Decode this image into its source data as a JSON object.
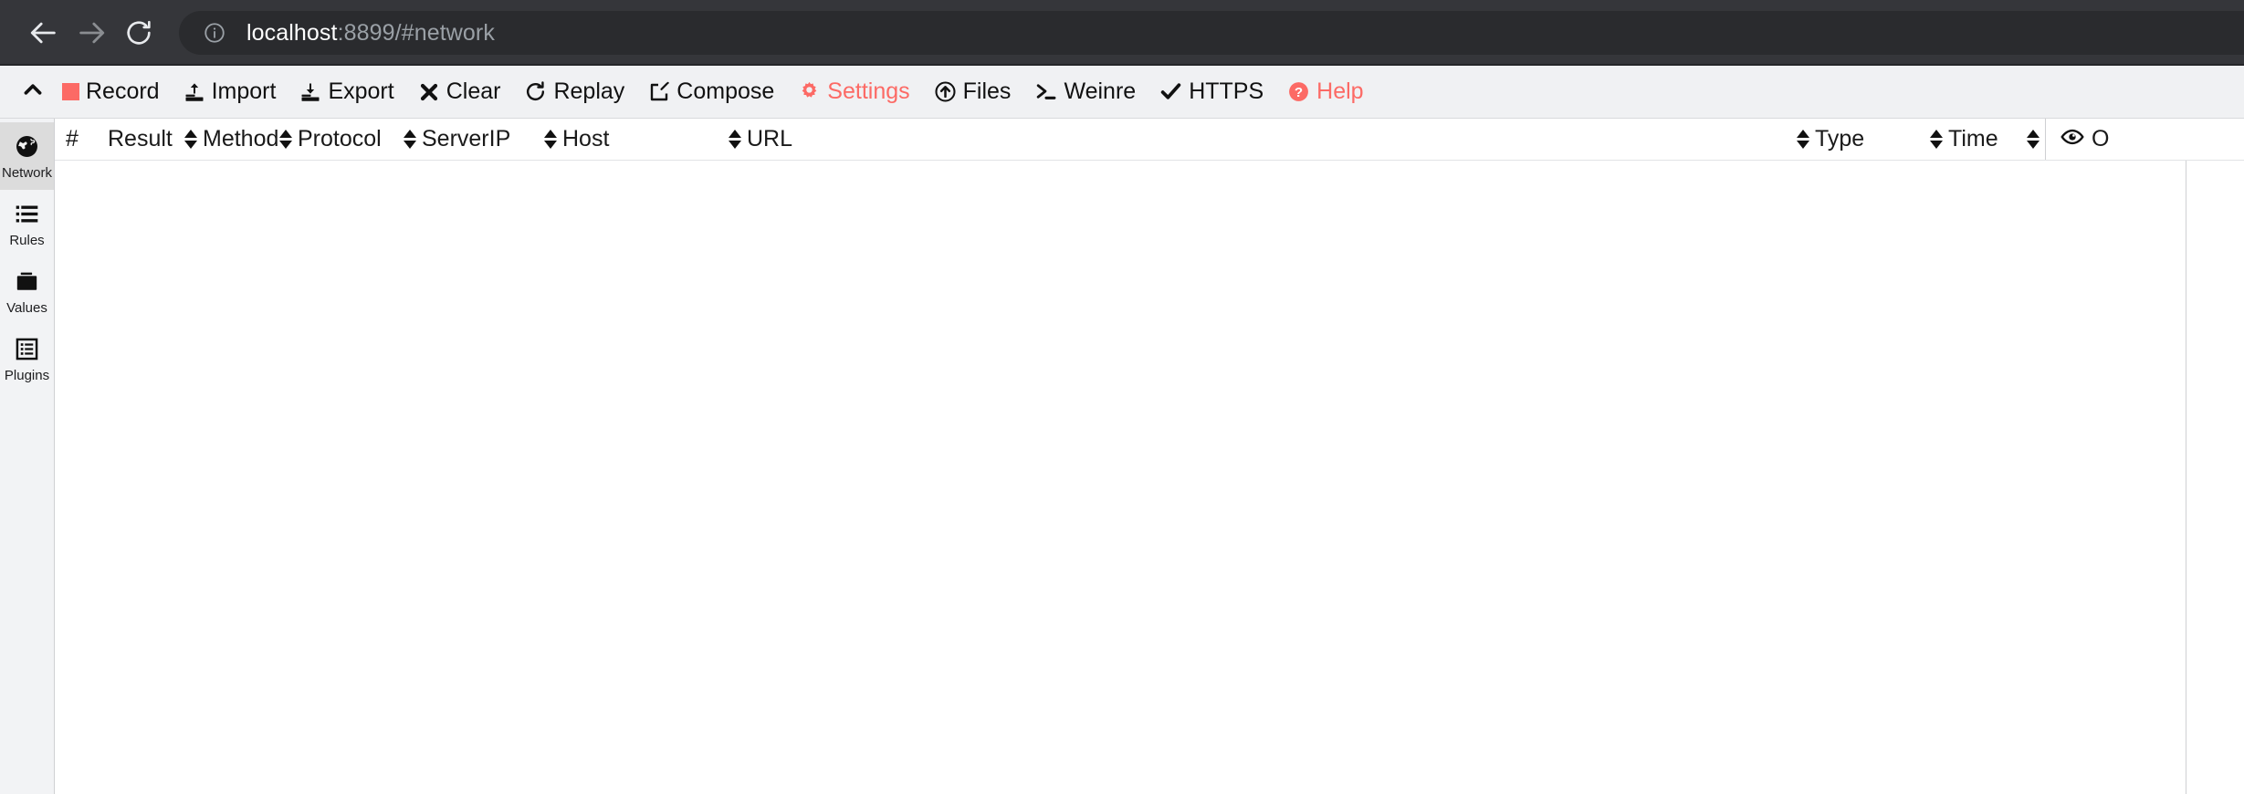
{
  "browser": {
    "back_icon": "arrow-left-icon",
    "forward_icon": "arrow-right-icon",
    "reload_icon": "reload-icon",
    "info_icon": "info-circle-icon",
    "url_host": "localhost",
    "url_rest": ":8899/#network"
  },
  "toolbar": {
    "collapse_icon": "chevron-up-icon",
    "accent_color": "#fc6a65",
    "items": [
      {
        "label": "Record",
        "icon": "record-square-icon",
        "accent": false
      },
      {
        "label": "Import",
        "icon": "import-icon",
        "accent": false
      },
      {
        "label": "Export",
        "icon": "export-icon",
        "accent": false
      },
      {
        "label": "Clear",
        "icon": "close-x-icon",
        "accent": false
      },
      {
        "label": "Replay",
        "icon": "refresh-icon",
        "accent": false
      },
      {
        "label": "Compose",
        "icon": "compose-icon",
        "accent": false
      },
      {
        "label": "Settings",
        "icon": "gear-icon",
        "accent": true
      },
      {
        "label": "Files",
        "icon": "upload-circle-icon",
        "accent": false
      },
      {
        "label": "Weinre",
        "icon": "terminal-icon",
        "accent": false
      },
      {
        "label": "HTTPS",
        "icon": "check-icon",
        "accent": false
      },
      {
        "label": "Help",
        "icon": "help-circle-icon",
        "accent": true
      }
    ]
  },
  "sidebar": {
    "items": [
      {
        "label": "Network",
        "icon": "globe-icon",
        "active": true
      },
      {
        "label": "Rules",
        "icon": "list-icon",
        "active": false
      },
      {
        "label": "Values",
        "icon": "folder-icon",
        "active": false
      },
      {
        "label": "Plugins",
        "icon": "plugins-icon",
        "active": false
      }
    ]
  },
  "table": {
    "columns": [
      {
        "label": "#",
        "sortable": false
      },
      {
        "label": "Result",
        "sortable": true
      },
      {
        "label": "Method",
        "sortable": true
      },
      {
        "label": "Protocol",
        "sortable": true
      },
      {
        "label": "ServerIP",
        "sortable": true
      },
      {
        "label": "Host",
        "sortable": true
      },
      {
        "label": "URL",
        "sortable": true
      },
      {
        "label": "Type",
        "sortable": true
      },
      {
        "label": "Time",
        "sortable": true
      }
    ],
    "rows": []
  },
  "overview": {
    "icon": "eye-icon",
    "label": "O"
  }
}
